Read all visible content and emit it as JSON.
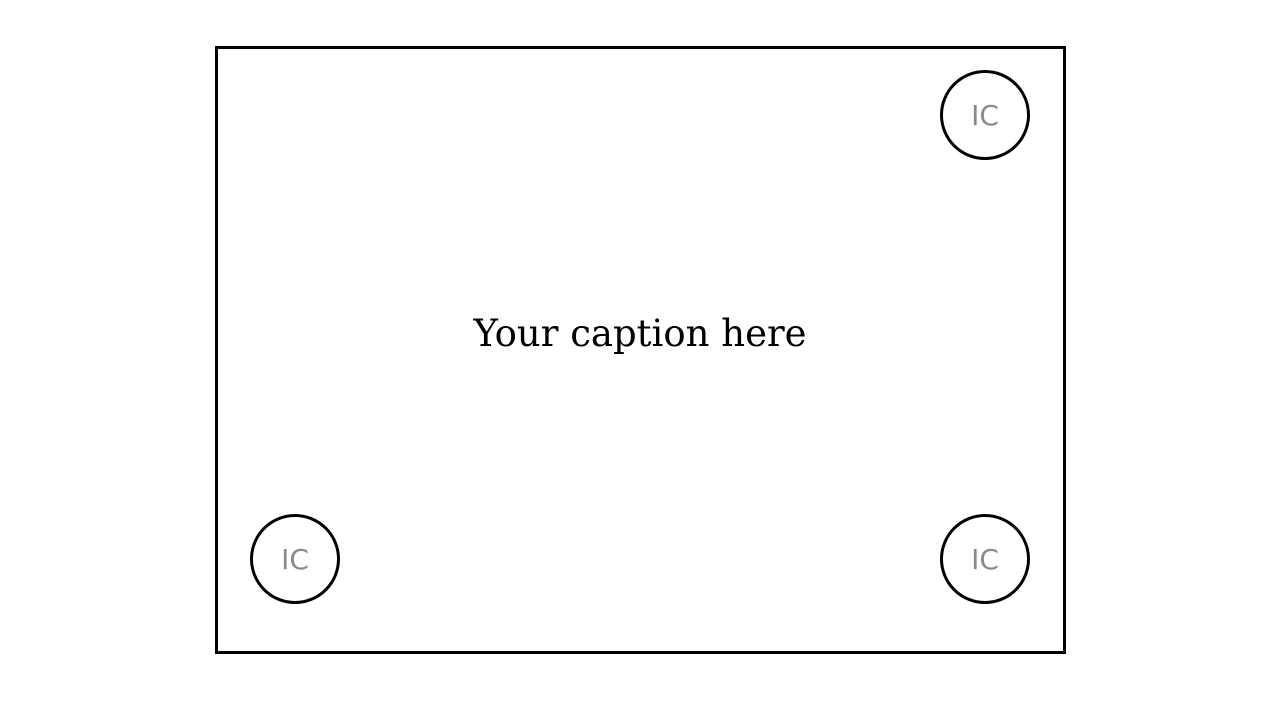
{
  "caption": "Your caption here",
  "badges": {
    "top_right": "IC",
    "bottom_left": "IC",
    "bottom_right": "IC"
  },
  "colors": {
    "border": "#000000",
    "badge_text": "#8a8a8a",
    "background": "#ffffff"
  }
}
